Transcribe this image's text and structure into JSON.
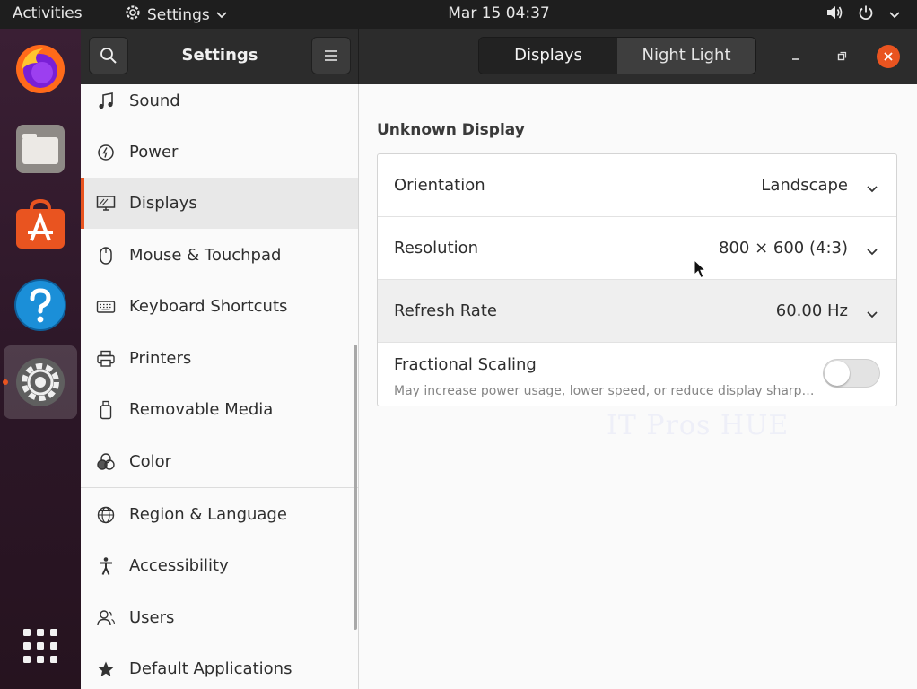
{
  "topbar": {
    "activities": "Activities",
    "app_menu": "Settings",
    "clock": "Mar 15  04:37"
  },
  "dock": {
    "apps": [
      "firefox-icon",
      "files-icon",
      "software-icon",
      "help-icon",
      "settings-icon",
      "app-grid-icon"
    ],
    "accent": "#e95420"
  },
  "header": {
    "title": "Settings",
    "tabs": [
      {
        "label": "Displays",
        "selected": true
      },
      {
        "label": "Night Light",
        "selected": false
      }
    ]
  },
  "sidebar": {
    "items": [
      {
        "label": "Sound",
        "icon": "music-note-icon"
      },
      {
        "label": "Power",
        "icon": "power-icon"
      },
      {
        "label": "Displays",
        "icon": "display-icon",
        "selected": true
      },
      {
        "label": "Mouse & Touchpad",
        "icon": "mouse-icon"
      },
      {
        "label": "Keyboard Shortcuts",
        "icon": "keyboard-icon"
      },
      {
        "label": "Printers",
        "icon": "printer-icon"
      },
      {
        "label": "Removable Media",
        "icon": "usb-drive-icon"
      },
      {
        "label": "Color",
        "icon": "color-icon"
      },
      {
        "label": "Region & Language",
        "icon": "globe-icon"
      },
      {
        "label": "Accessibility",
        "icon": "accessibility-icon"
      },
      {
        "label": "Users",
        "icon": "users-icon"
      },
      {
        "label": "Default Applications",
        "icon": "star-icon"
      }
    ]
  },
  "main": {
    "section_title": "Unknown Display",
    "rows": {
      "orientation": {
        "label": "Orientation",
        "value": "Landscape"
      },
      "resolution": {
        "label": "Resolution",
        "value": "800 × 600 (4:3)"
      },
      "refresh_rate": {
        "label": "Refresh Rate",
        "value": "60.00 Hz"
      },
      "fractional_scaling": {
        "label": "Fractional Scaling",
        "subtitle": "May increase power usage, lower speed, or reduce display sharp…",
        "enabled": false
      }
    }
  },
  "watermark": "IT Pros HUE"
}
